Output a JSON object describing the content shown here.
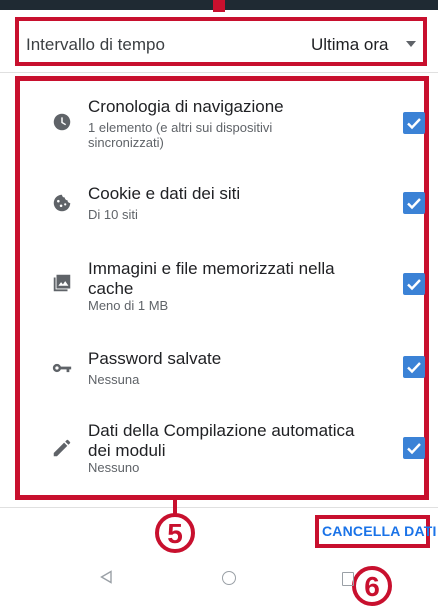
{
  "time_range": {
    "label": "Intervallo di tempo",
    "value": "Ultima ora"
  },
  "items": [
    {
      "icon": "history-icon",
      "title": "Cronologia di navigazione",
      "subtitle": "1 elemento (e altri sui dispositivi sincronizzati)",
      "checked": true
    },
    {
      "icon": "cookie-icon",
      "title": "Cookie e dati dei siti",
      "subtitle": "Di 10 siti",
      "checked": true
    },
    {
      "icon": "image-icon",
      "title": "Immagini e file memorizzati nella cache",
      "subtitle": "Meno di 1 MB",
      "checked": true
    },
    {
      "icon": "key-icon",
      "title": "Password salvate",
      "subtitle": "Nessuna",
      "checked": true
    },
    {
      "icon": "pencil-icon",
      "title": "Dati della Compilazione automatica dei moduli",
      "subtitle": "Nessuno",
      "checked": true
    }
  ],
  "clear_button": "CANCELLA DATI",
  "annotations": {
    "badge_list": "5",
    "badge_clear": "6"
  },
  "colors": {
    "accent": "#1a73e8",
    "checkbox": "#3b82d6",
    "highlight": "#c8102e"
  }
}
